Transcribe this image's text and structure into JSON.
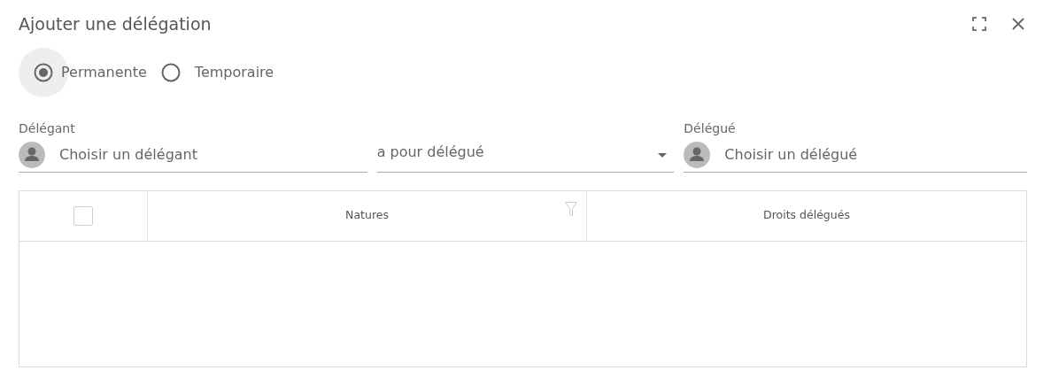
{
  "dialog": {
    "title": "Ajouter une délégation"
  },
  "mode_options": [
    {
      "label": "Permanente",
      "selected": true
    },
    {
      "label": "Temporaire",
      "selected": false
    }
  ],
  "delegator": {
    "label": "Délégant",
    "placeholder": "Choisir un délégant"
  },
  "relation": {
    "value": "a pour délégué"
  },
  "delegate": {
    "label": "Délégué",
    "placeholder": "Choisir un délégué"
  },
  "table": {
    "select_all": {
      "checked": false
    },
    "columns": [
      {
        "label": "Natures",
        "kind": "filterable"
      },
      {
        "label": "Droits délégués",
        "kind": "plain"
      }
    ]
  }
}
